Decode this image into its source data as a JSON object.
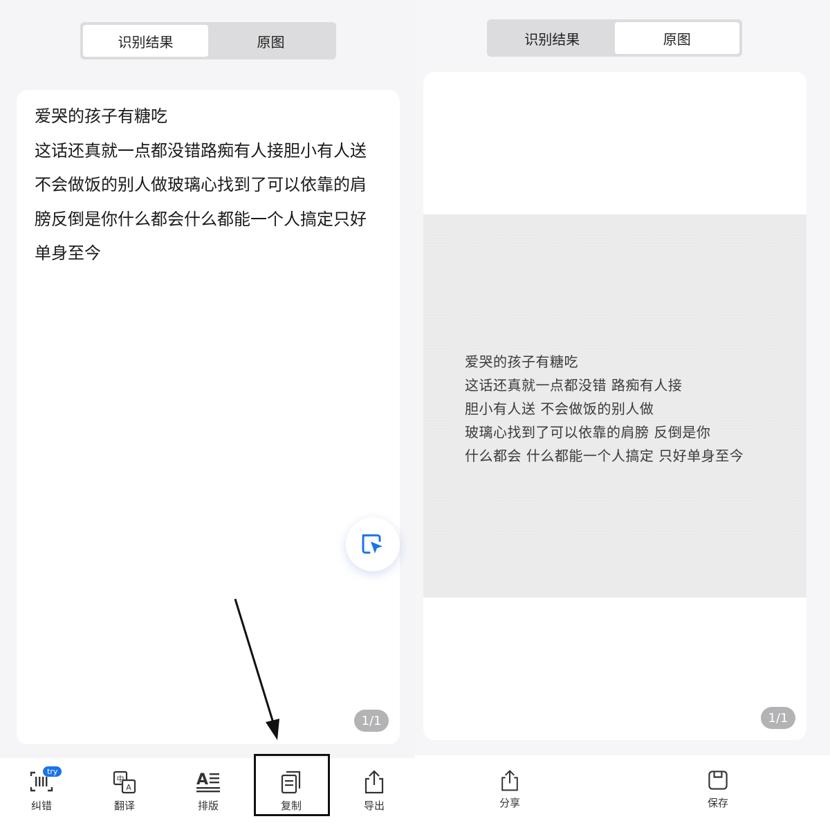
{
  "left": {
    "tabs": [
      {
        "label": "识别结果",
        "active": true
      },
      {
        "label": "原图",
        "active": false
      }
    ],
    "ocr_lines": [
      "爱哭的孩子有糖吃",
      "这话还真就一点都没错路痴有人接胆小有人送",
      "不会做饭的别人做玻璃心找到了可以依靠的肩",
      "膀反倒是你什么都会什么都能一个人搞定只好",
      "单身至今"
    ],
    "page_indicator": "1/1",
    "toolbar": [
      {
        "label": "纠错",
        "icon": "barcode-icon",
        "badge": "try"
      },
      {
        "label": "翻译",
        "icon": "translate-icon"
      },
      {
        "label": "排版",
        "icon": "text-format-icon"
      },
      {
        "label": "复制",
        "icon": "copy-icon"
      },
      {
        "label": "导出",
        "icon": "export-icon"
      }
    ]
  },
  "right": {
    "tabs": [
      {
        "label": "识别结果",
        "active": false
      },
      {
        "label": "原图",
        "active": true
      }
    ],
    "photo_lines": [
      "爱哭的孩子有糖吃",
      "这话还真就一点都没错  路痴有人接",
      "胆小有人送  不会做饭的别人做",
      "玻璃心找到了可以依靠的肩膀  反倒是你",
      "什么都会  什么都能一个人搞定  只好单身至今"
    ],
    "page_indicator": "1/1",
    "toolbar": [
      {
        "label": "分享",
        "icon": "share-icon"
      },
      {
        "label": "保存",
        "icon": "save-icon"
      }
    ]
  },
  "colors": {
    "accent": "#1a73e8",
    "panel_bg": "#f5f5f7",
    "segment_bg": "#dcdcde",
    "highlight": "#111111"
  }
}
